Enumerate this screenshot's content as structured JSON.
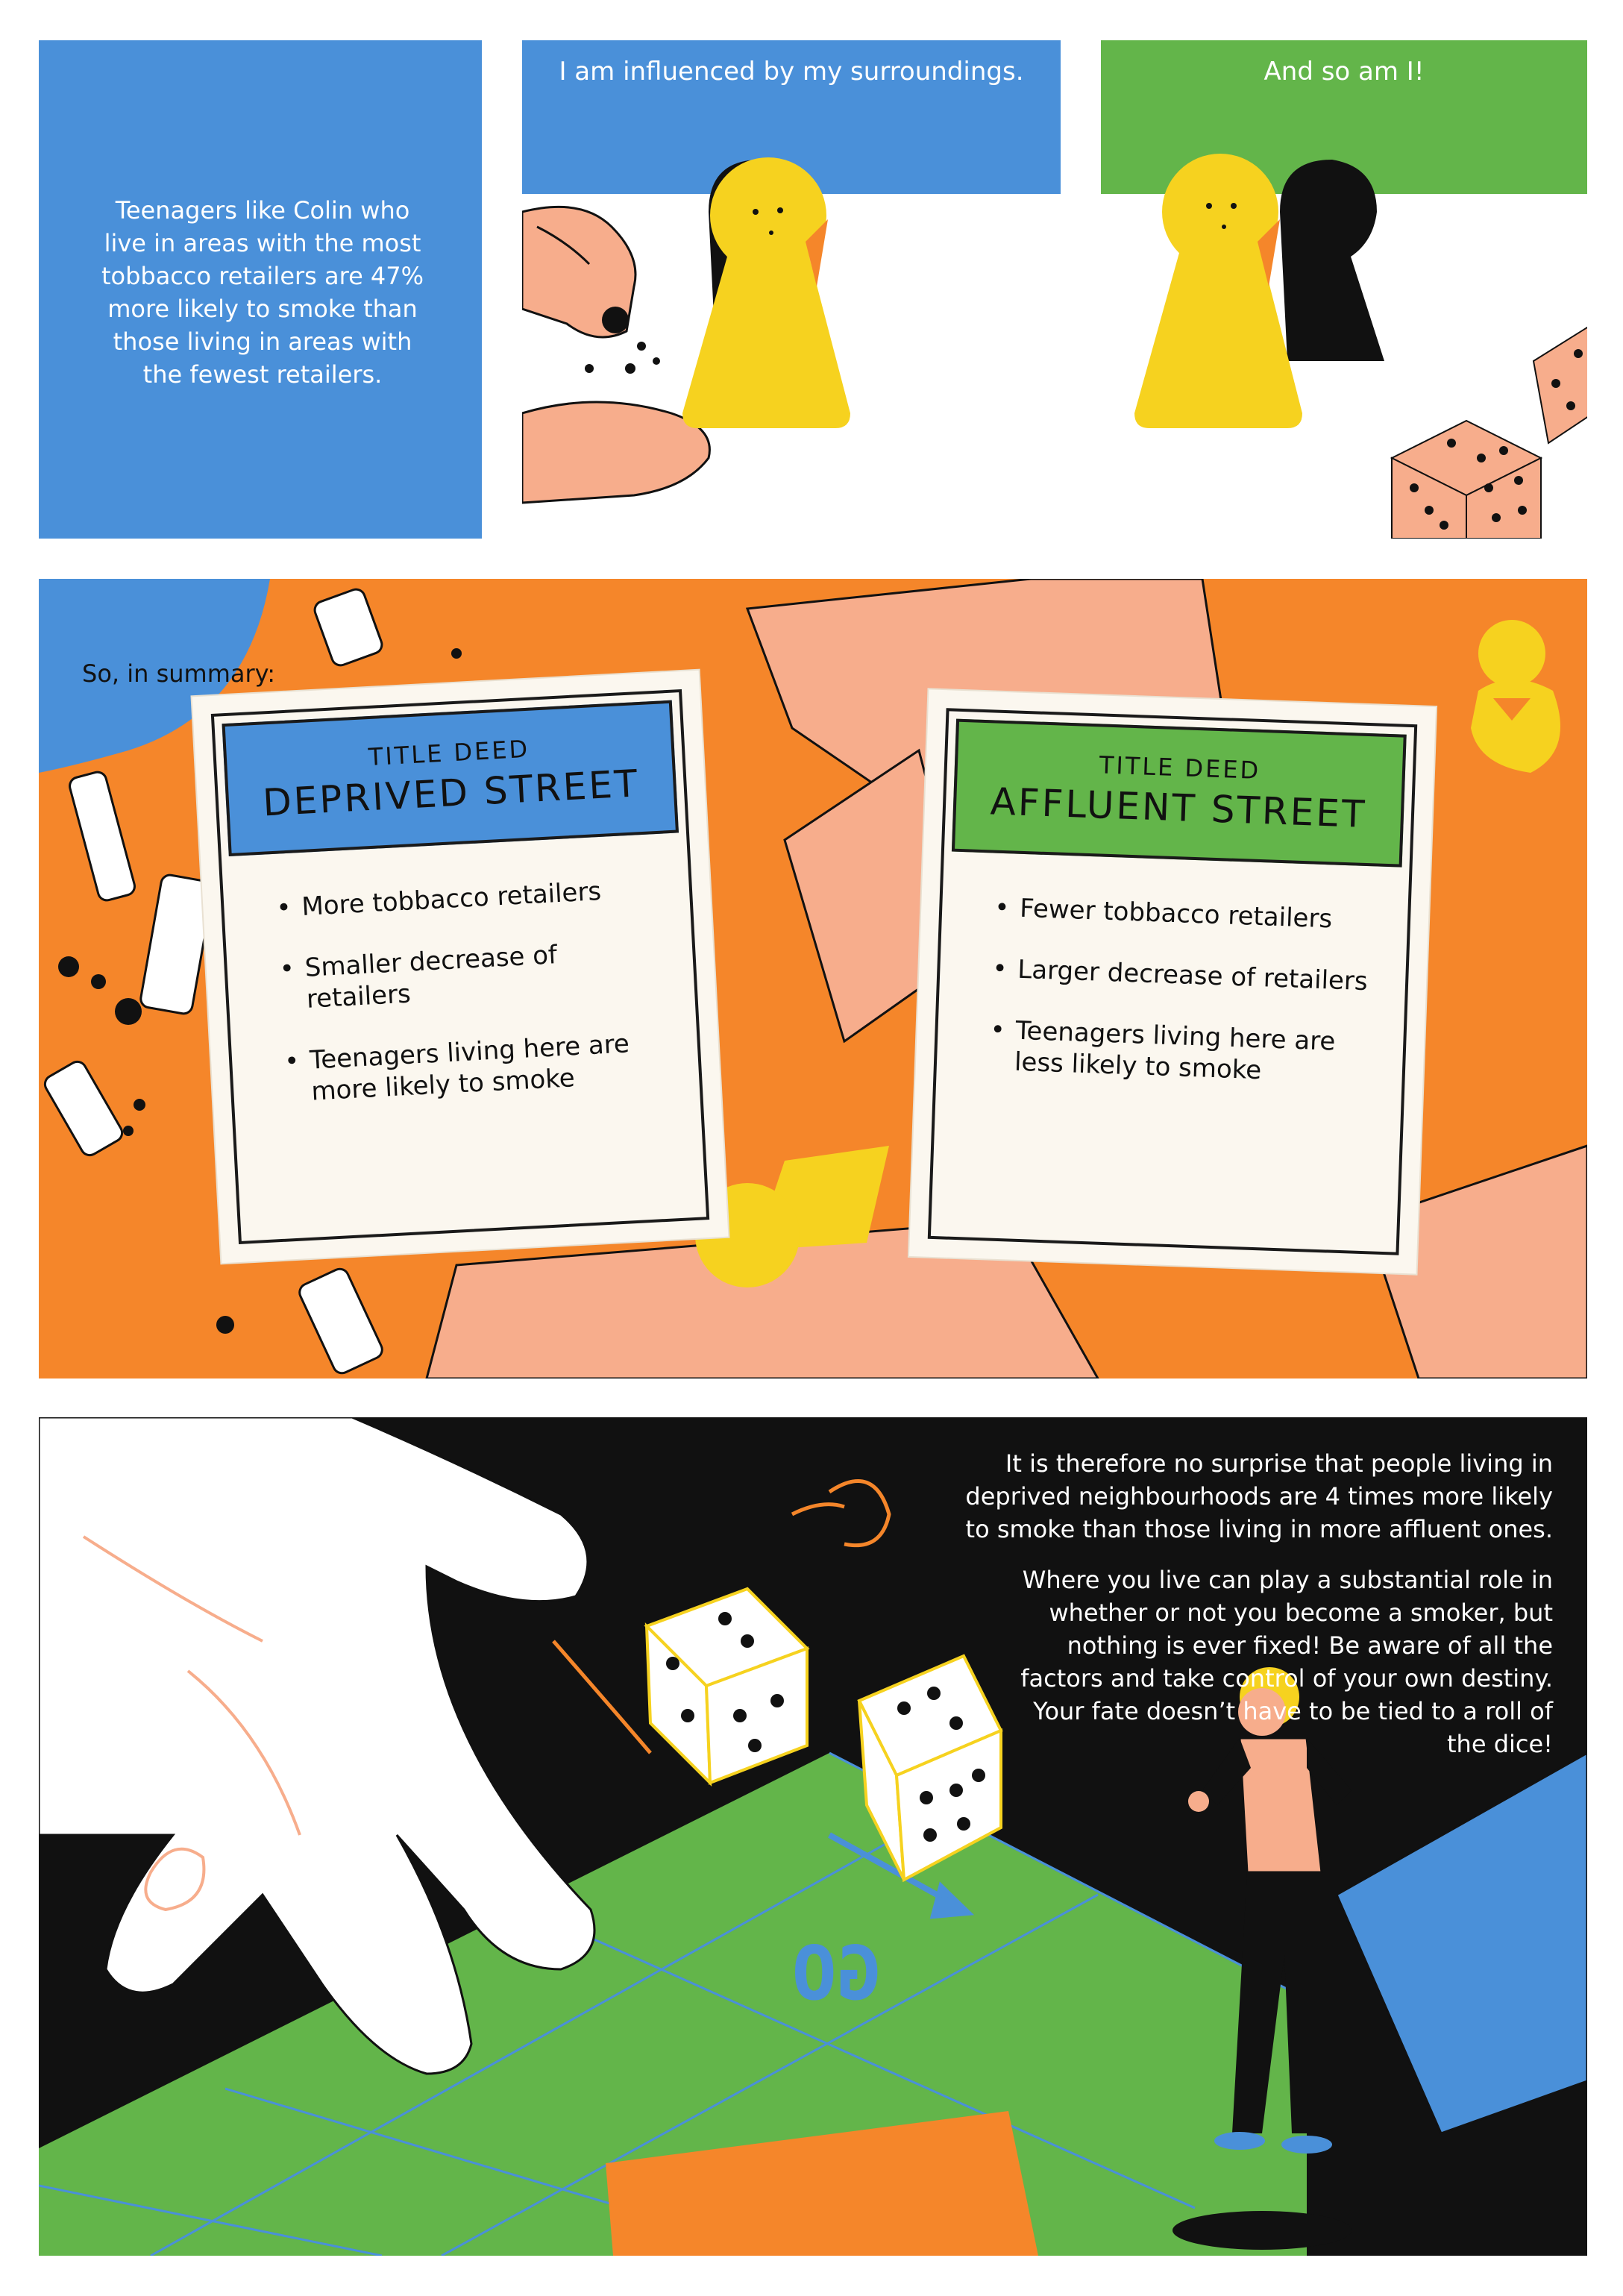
{
  "colors": {
    "blue": "#4a90d9",
    "green": "#63b54a",
    "orange": "#f5862a",
    "pink": "#f7ad8c",
    "yellow": "#f6d21f",
    "black": "#111111",
    "white": "#ffffff"
  },
  "panel1": {
    "text": "Teenagers like Colin who live in areas with the most tobbacco retailers are 47% more likely to smoke than those living in areas with the fewest retailers."
  },
  "panel2": {
    "speech": "I am influenced by my surroundings."
  },
  "panel3": {
    "speech": "And so am I!"
  },
  "panel4": {
    "intro": "So, in summary:",
    "deed_left": {
      "subtitle": "TITLE DEED",
      "name": "DEPRIVED STREET",
      "items": [
        "More tobbacco retailers",
        "Smaller decrease of retailers",
        "Teenagers living here are more likely to smoke"
      ]
    },
    "deed_right": {
      "subtitle": "TITLE DEED",
      "name": "AFFLUENT STREET",
      "items": [
        "Fewer tobbacco retailers",
        "Larger decrease of retailers",
        "Teenagers living here are less likely to smoke"
      ]
    }
  },
  "panel5": {
    "paragraph1": "It is therefore no surprise that people living in deprived neighbourhoods are 4 times more likely to smoke than those living in more affluent ones.",
    "paragraph2": "Where you live can play a substantial role in whether or not you become a smoker, but nothing is ever fixed! Be aware of all the factors and take control of your own destiny. Your fate doesn’t have to be tied to a roll of the dice!",
    "board_label": "GO"
  }
}
